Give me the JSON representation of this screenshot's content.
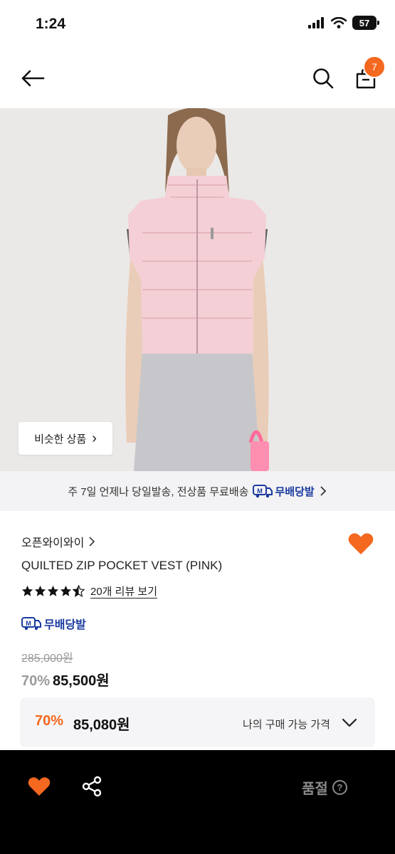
{
  "status_bar": {
    "time": "1:24",
    "battery": "57"
  },
  "nav": {
    "cart_count": "7"
  },
  "hero": {
    "similar_button_label": "비슷한 상품",
    "similar_chevron": "›"
  },
  "shipping_banner": {
    "text": "주 7일 언제나 당일발송, 전상품 무료배송",
    "logo_text": "무배당발",
    "logo_mark": "M"
  },
  "product": {
    "brand": "오픈와이와이",
    "name": "QUILTED ZIP POCKET VEST (PINK)",
    "rating": 4.5,
    "review_link": "20개 리뷰 보기",
    "free_ship_label": "무배당발",
    "original_price": "285,000원",
    "discount": "70%",
    "price": "85,500원"
  },
  "my_price": {
    "discount": "70%",
    "price": "85,080원",
    "label": "나의 구매 가능 가격"
  },
  "bottom_bar": {
    "status_label": "품절",
    "help_glyph": "?"
  },
  "colors": {
    "accent": "#f4681f",
    "brand_blue": "#1a3a9e",
    "vest_pink": "#f4cfd5"
  },
  "icons": [
    "back-arrow-icon",
    "search-icon",
    "shopping-bag-icon",
    "heart-icon",
    "share-icon",
    "chevron-right-icon",
    "chevron-down-icon",
    "star-icon",
    "truck-icon",
    "help-icon"
  ]
}
